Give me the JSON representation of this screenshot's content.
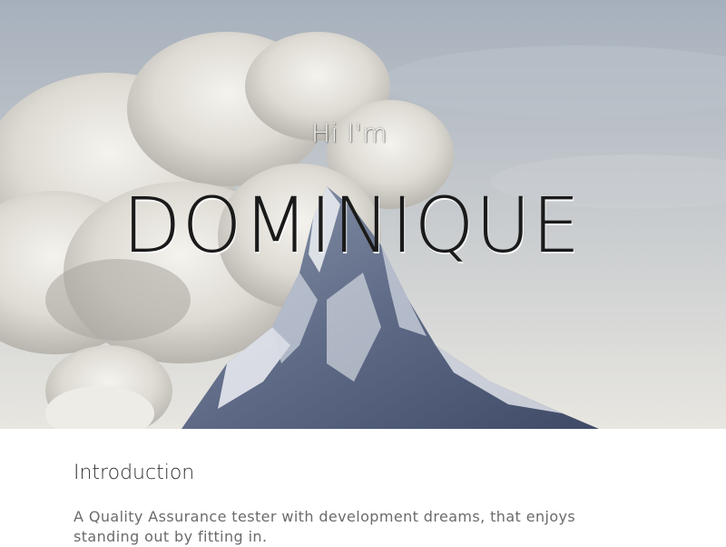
{
  "hero": {
    "greeting": "Hi I'm",
    "name": "DOMINIQUE",
    "background_image": "mountain-peak-with-clouds",
    "colors": {
      "name_text": "#1a1a1a",
      "greeting_text": "#f4f2ee"
    }
  },
  "intro": {
    "title": "Introduction",
    "text": "A Quality Assurance tester with development dreams, that enjoys standing out by fitting in."
  }
}
